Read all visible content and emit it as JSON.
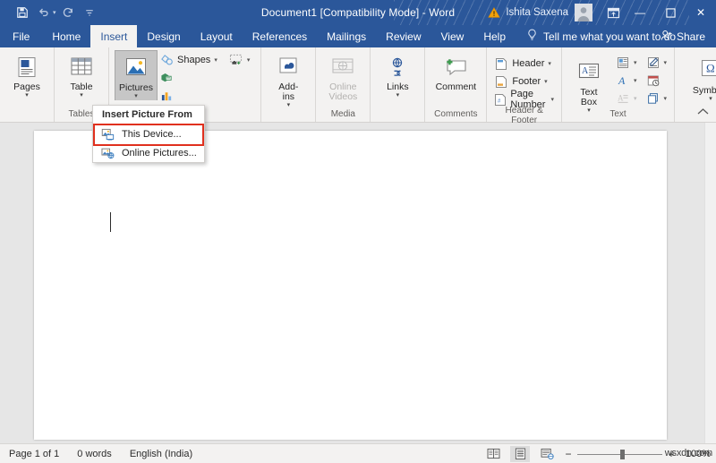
{
  "titlebar": {
    "document_title": "Document1 [Compatibility Mode]  -  Word",
    "account_name": "Ishita Saxena",
    "warning_icon": "warning-triangle-icon",
    "avatar_icon": "account-avatar-icon",
    "ribbon_display_options_icon": "ribbon-display-options-icon",
    "minimize_label": "—",
    "restore_label": "☐",
    "close_label": "✕",
    "qat": [
      {
        "name": "save",
        "icon": "save-icon"
      },
      {
        "name": "undo",
        "icon": "undo-icon",
        "has_dropdown": true
      },
      {
        "name": "redo",
        "icon": "redo-icon"
      },
      {
        "name": "customize-quick-access-toolbar",
        "icon": "customize-qat-icon"
      }
    ]
  },
  "ribbon": {
    "tabs": [
      {
        "label": "File",
        "active": false
      },
      {
        "label": "Home",
        "active": false
      },
      {
        "label": "Insert",
        "active": true
      },
      {
        "label": "Design",
        "active": false
      },
      {
        "label": "Layout",
        "active": false
      },
      {
        "label": "References",
        "active": false
      },
      {
        "label": "Mailings",
        "active": false
      },
      {
        "label": "Review",
        "active": false
      },
      {
        "label": "View",
        "active": false
      },
      {
        "label": "Help",
        "active": false
      }
    ],
    "tell_me": "Tell me what you want to do",
    "tell_me_icon": "lightbulb-icon",
    "share_label": "Share",
    "share_icon": "share-person-icon",
    "collapse_icon": "chevron-up-icon",
    "groups": [
      {
        "label": "",
        "name": "pages-group",
        "buttons": [
          {
            "label": "Pages",
            "icon": "pages-icon",
            "dropdown": true
          }
        ]
      },
      {
        "label": "Tables",
        "name": "tables-group",
        "buttons": [
          {
            "label": "Table",
            "icon": "table-icon",
            "dropdown": true
          }
        ]
      },
      {
        "label": "",
        "name": "illustrations-group",
        "buttons": [
          {
            "label": "Pictures",
            "icon": "pictures-icon",
            "dropdown": true,
            "active": true
          }
        ],
        "small_items": [
          {
            "label": "Shapes",
            "icon": "shapes-icon",
            "dropdown": true
          },
          {
            "label": "",
            "icon": "icons-icon",
            "dropdown": false
          },
          {
            "label": "",
            "icon": "chart-icon",
            "dropdown": false
          },
          {
            "label": "",
            "icon": "screenshot-icon",
            "dropdown": true
          }
        ]
      },
      {
        "label": "",
        "name": "add-ins-group",
        "buttons": [
          {
            "label": "Add-\nins",
            "icon": "add-ins-icon",
            "dropdown": true
          }
        ]
      },
      {
        "label": "Media",
        "name": "media-group",
        "buttons": [
          {
            "label": "Online\nVideos",
            "icon": "online-video-icon",
            "dropdown": false,
            "disabled": true
          }
        ]
      },
      {
        "label": "",
        "name": "links-group",
        "buttons": [
          {
            "label": "Links",
            "icon": "links-icon",
            "dropdown": true
          }
        ]
      },
      {
        "label": "Comments",
        "name": "comments-group",
        "buttons": [
          {
            "label": "Comment",
            "icon": "new-comment-icon",
            "dropdown": false
          }
        ]
      },
      {
        "label": "Header & Footer",
        "name": "header-footer-group",
        "small_items": [
          {
            "label": "Header",
            "icon": "header-icon",
            "dropdown": true
          },
          {
            "label": "Footer",
            "icon": "footer-icon",
            "dropdown": true
          },
          {
            "label": "Page Number",
            "icon": "page-number-icon",
            "dropdown": true
          }
        ]
      },
      {
        "label": "Text",
        "name": "text-group",
        "buttons": [
          {
            "label": "Text\nBox",
            "icon": "text-box-icon",
            "dropdown": true
          }
        ],
        "small_items": [
          {
            "label": "",
            "icon": "quick-parts-icon",
            "dropdown": true
          },
          {
            "label": "",
            "icon": "wordart-icon",
            "dropdown": true
          },
          {
            "label": "",
            "icon": "drop-cap-icon",
            "dropdown": true,
            "disabled": true
          },
          {
            "label": "",
            "icon": "signature-line-icon",
            "dropdown": true
          },
          {
            "label": "",
            "icon": "date-time-icon",
            "dropdown": false
          },
          {
            "label": "",
            "icon": "object-icon",
            "dropdown": true
          }
        ]
      },
      {
        "label": "",
        "name": "symbols-group",
        "buttons": [
          {
            "label": "Symbols",
            "icon": "omega-icon",
            "dropdown": true
          }
        ]
      }
    ]
  },
  "pictures_menu": {
    "header": "Insert Picture From",
    "items": [
      {
        "label": "This Device...",
        "icon": "this-device-icon",
        "highlighted": true
      },
      {
        "label": "Online Pictures...",
        "icon": "online-pictures-icon",
        "highlighted": false
      }
    ],
    "highlight_color": "#e0301e"
  },
  "document": {
    "page_background": "#ffffff",
    "canvas_background": "#e6e6e6"
  },
  "statusbar": {
    "page_info": "Page 1 of 1",
    "word_count": "0 words",
    "language": "English (India)",
    "views": [
      {
        "name": "read-mode",
        "icon": "read-mode-icon",
        "selected": false
      },
      {
        "name": "print-layout",
        "icon": "print-layout-icon",
        "selected": true
      },
      {
        "name": "web-layout",
        "icon": "web-layout-icon",
        "selected": false
      }
    ],
    "zoom_out_label": "−",
    "zoom_in_label": "+",
    "zoom_percent": "100%"
  },
  "watermark": {
    "text": "wsxdn.com"
  },
  "colors": {
    "word_blue": "#2b579a",
    "ribbon_bg": "#f3f2f1",
    "highlight_red": "#e0301e",
    "canvas_gray": "#e6e6e6"
  }
}
